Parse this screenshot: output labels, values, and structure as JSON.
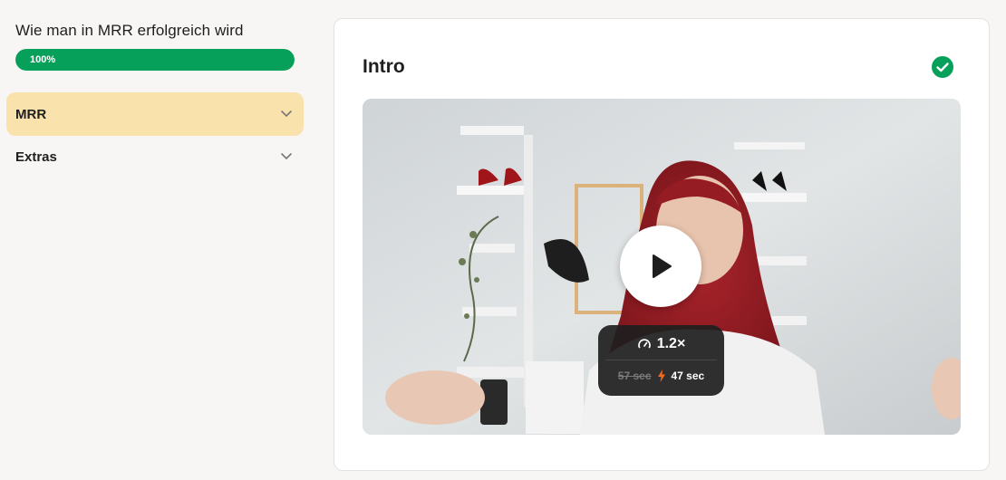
{
  "sidebar": {
    "course_title": "Wie man in MRR erfolgreich wird",
    "progress": {
      "value": 1.0,
      "label": "100%",
      "color": "#07a05a"
    },
    "items": [
      {
        "label": "MRR",
        "active": true
      },
      {
        "label": "Extras",
        "active": false
      }
    ]
  },
  "lesson": {
    "title": "Intro",
    "completed_icon": "check-circle-icon",
    "video": {
      "speed_label": "1.2×",
      "original_duration": "57 sec",
      "fast_duration": "47 sec"
    }
  },
  "colors": {
    "accent_green": "#07a05a",
    "active_item_bg": "#fae2ad",
    "lightning": "#f26b1d"
  }
}
